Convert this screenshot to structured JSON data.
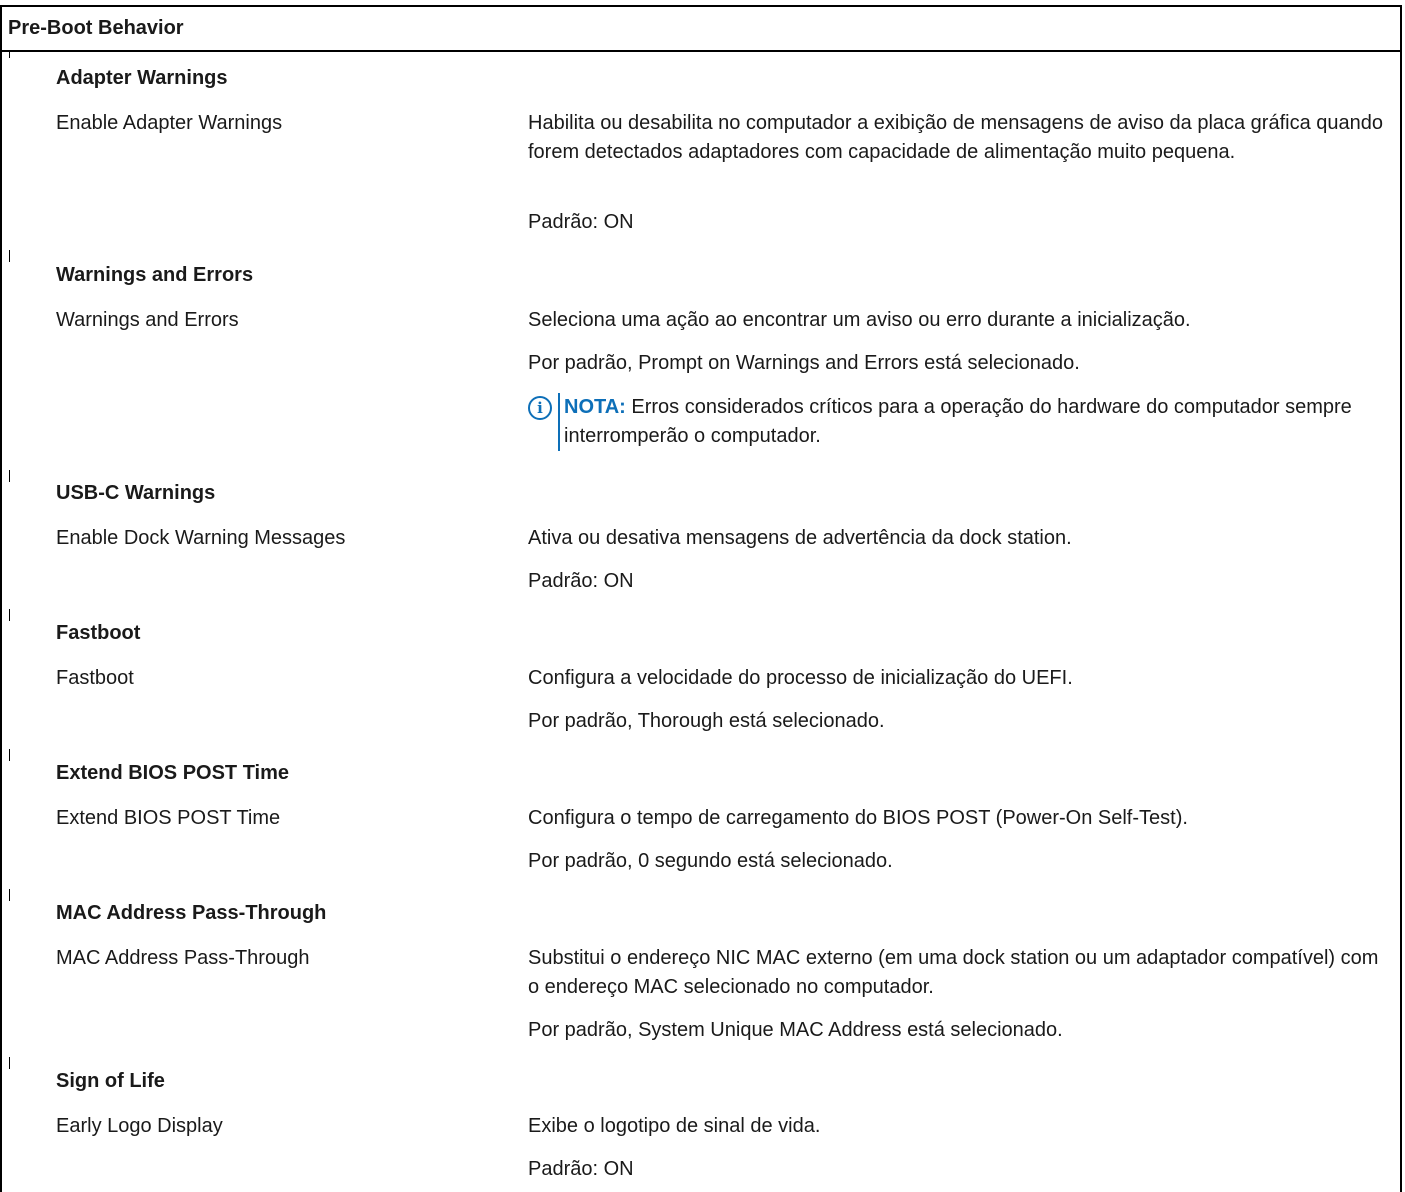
{
  "header": {
    "title": "Pre-Boot Behavior"
  },
  "groups": [
    {
      "title": "Adapter Warnings",
      "settings": [
        {
          "name": "Enable Adapter Warnings",
          "lines": [
            "Habilita ou desabilita no computador a exibição de mensagens de aviso da placa gráfica quando forem detectados adaptadores com capacidade de alimentação muito pequena.",
            "Padrão: ON"
          ]
        }
      ]
    },
    {
      "title": "Warnings and Errors",
      "settings": [
        {
          "name": "Warnings and Errors",
          "lines": [
            "Seleciona uma ação ao encontrar um aviso ou erro durante a inicialização.",
            "Por padrão, Prompt on Warnings and Errors está selecionado."
          ],
          "note": {
            "icon": "info-icon",
            "label": "NOTA:",
            "text": " Erros considerados críticos para a operação do hardware do computador sempre interromperão o computador."
          }
        }
      ]
    },
    {
      "title": "USB-C Warnings",
      "settings": [
        {
          "name": "Enable Dock Warning Messages",
          "lines": [
            "Ativa ou desativa mensagens de advertência da dock station.",
            "Padrão: ON"
          ]
        }
      ]
    },
    {
      "title": "Fastboot",
      "settings": [
        {
          "name": "Fastboot",
          "lines": [
            "Configura a velocidade do processo de inicialização do UEFI.",
            "Por padrão, Thorough está selecionado."
          ]
        }
      ]
    },
    {
      "title": "Extend BIOS POST Time",
      "settings": [
        {
          "name": "Extend BIOS POST Time",
          "lines": [
            "Configura o tempo de carregamento do BIOS POST (Power-On Self-Test).",
            "Por padrão, 0 segundo está selecionado."
          ]
        }
      ]
    },
    {
      "title": "MAC Address Pass-Through",
      "settings": [
        {
          "name": "MAC Address Pass-Through",
          "lines": [
            "Substitui o endereço NIC MAC externo (em uma dock station ou um adaptador compatível) com o endereço MAC selecionado no computador.",
            "Por padrão, System Unique MAC Address está selecionado."
          ]
        }
      ]
    },
    {
      "title": "Sign of Life",
      "settings": [
        {
          "name": "Early Logo Display",
          "lines": [
            "Exibe o logotipo de sinal de vida.",
            "Padrão: ON"
          ]
        }
      ]
    }
  ],
  "colors": {
    "note_accent": "#0d6fb8",
    "rule": "#000000",
    "text": "#1a1a1a"
  }
}
